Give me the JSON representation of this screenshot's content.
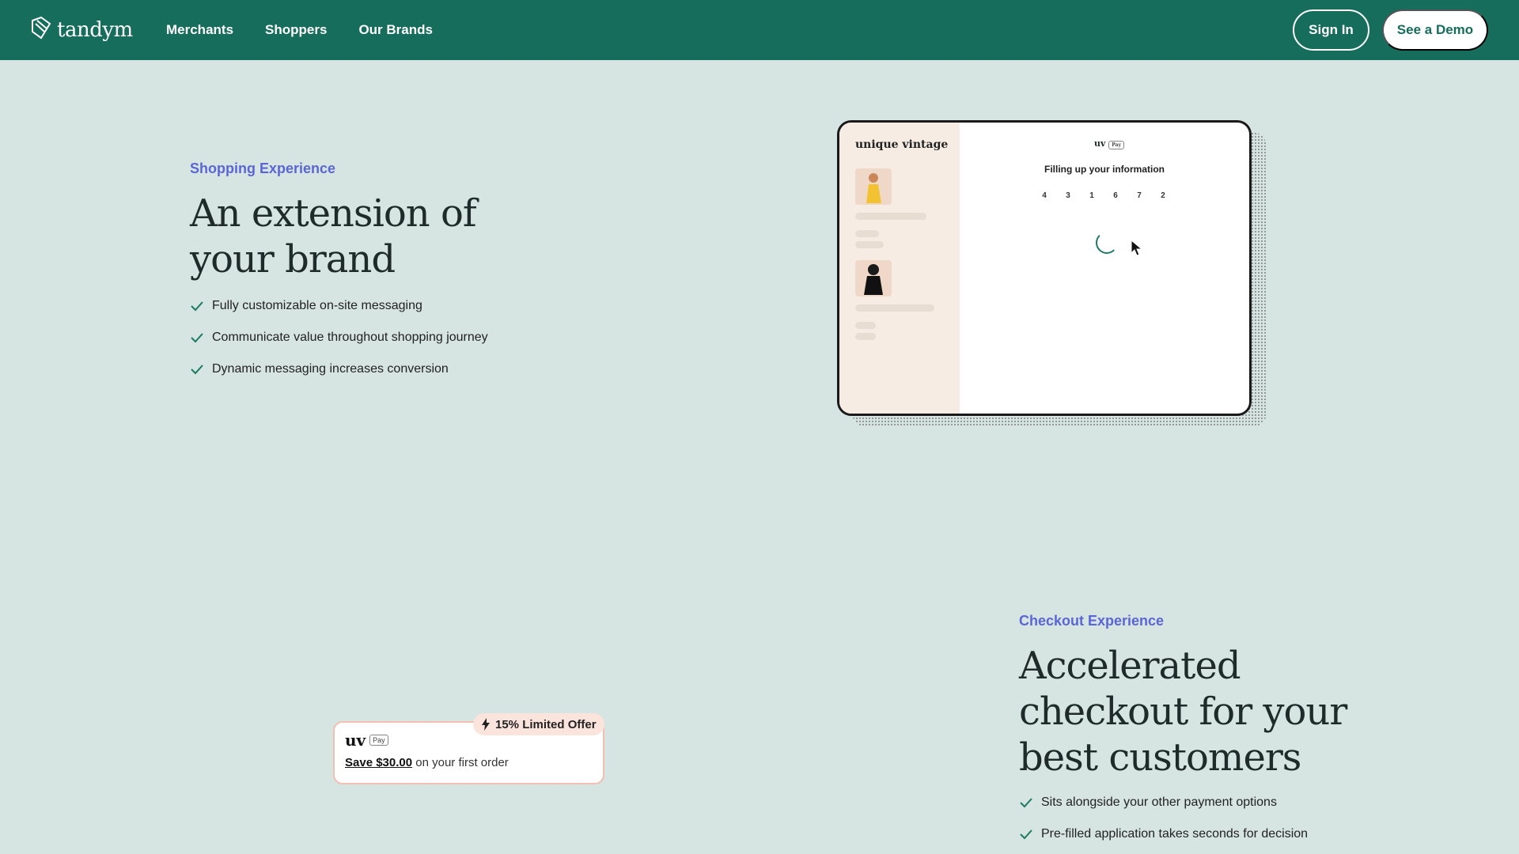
{
  "nav": {
    "logo_text": "tandym",
    "links": [
      "Merchants",
      "Shoppers",
      "Our Brands"
    ],
    "sign_in": "Sign In",
    "demo": "See a Demo"
  },
  "shopping": {
    "eyebrow": "Shopping Experience",
    "headline_line1": "An extension of",
    "headline_line2": "your brand",
    "features": [
      "Fully customizable on-site messaging",
      "Communicate value throughout shopping journey",
      "Dynamic messaging increases conversion"
    ]
  },
  "device": {
    "brand": "unique vintage",
    "mini_logo": "uv",
    "mini_pay": "Pay",
    "form_title": "Filling up your information",
    "code_digits": [
      "4",
      "3",
      "1",
      "6",
      "7",
      "2"
    ]
  },
  "checkout": {
    "eyebrow": "Checkout Experience",
    "headline_line1": "Accelerated",
    "headline_line2": "checkout for your",
    "headline_line3": "best customers",
    "features": [
      "Sits alongside your other payment options",
      "Pre-filled application takes seconds for decision"
    ]
  },
  "offer": {
    "badge": "15% Limited Offer",
    "logo": "uv",
    "pay_tag": "Pay",
    "save_amount": "Save $30.00",
    "rest": " on your first order"
  },
  "colors": {
    "nav_bg": "#166d5c",
    "page_bg": "#d6e5e1",
    "eyebrow": "#5b66d6",
    "check": "#1c7a63"
  }
}
